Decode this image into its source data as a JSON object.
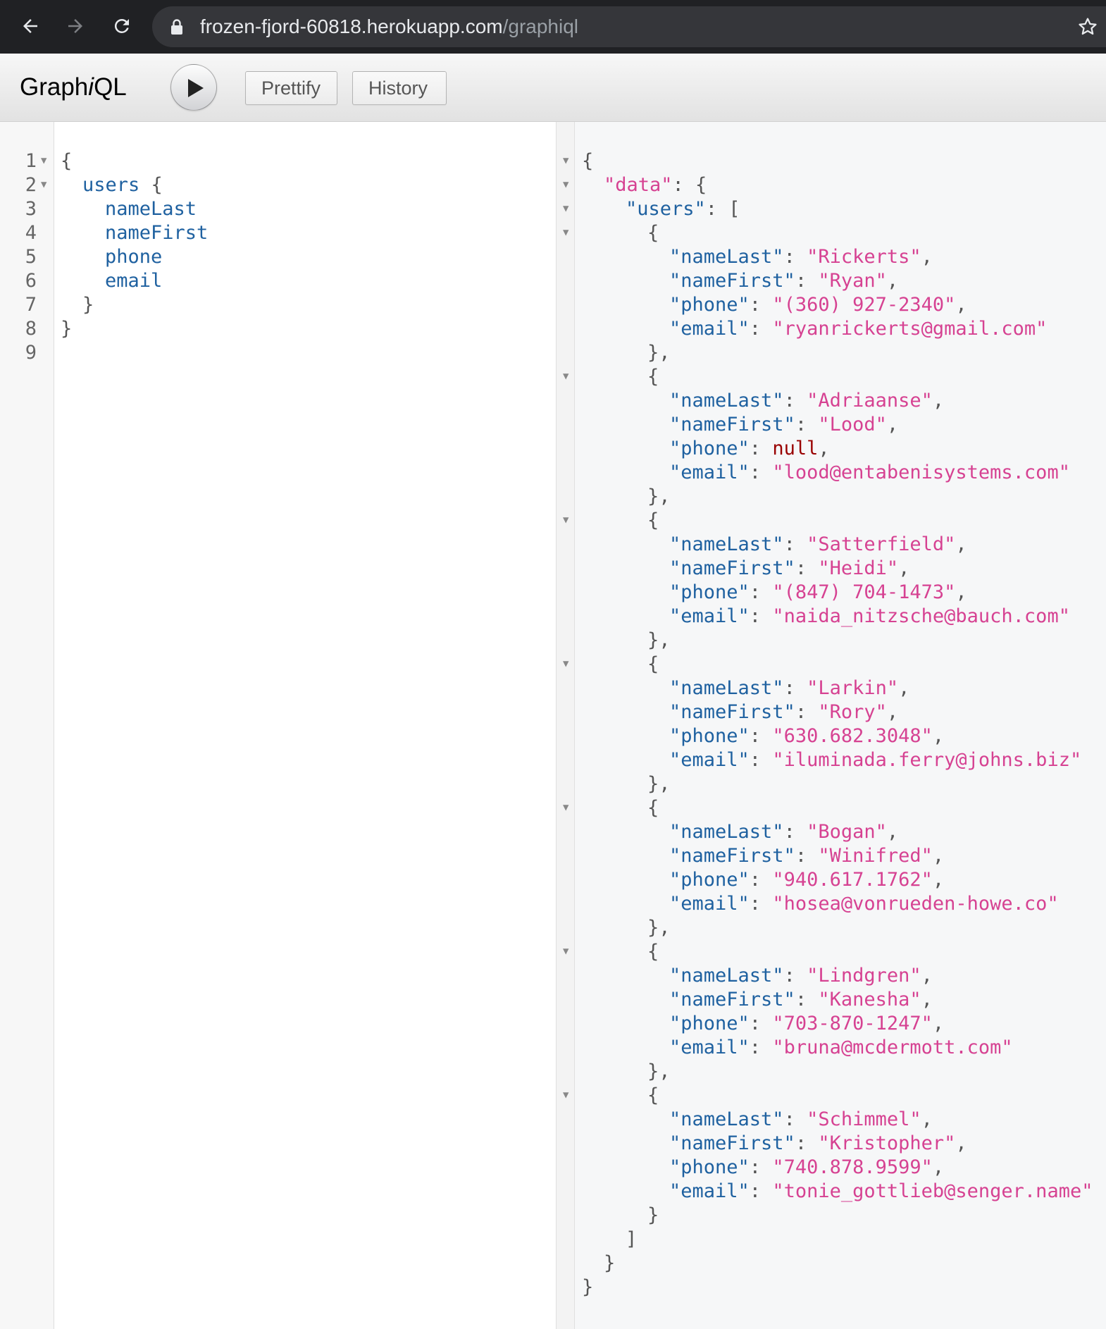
{
  "browser": {
    "url_host": "frozen-fjord-60818.herokuapp.com",
    "url_path": "/graphiql"
  },
  "toolbar": {
    "logo_prefix": "Graph",
    "logo_italic": "i",
    "logo_suffix": "QL",
    "prettify_label": "Prettify",
    "history_label": "History"
  },
  "query": {
    "line_numbers": [
      "1",
      "2",
      "3",
      "4",
      "5",
      "6",
      "7",
      "8",
      "9"
    ],
    "open_brace": "{",
    "root_field": "users",
    "root_brace": "{",
    "fields": [
      "nameLast",
      "nameFirst",
      "phone",
      "email"
    ],
    "inner_close": "}",
    "outer_close": "}"
  },
  "result": {
    "data_key": "\"data\"",
    "users_key": "\"users\"",
    "field_keys": {
      "nameLast": "\"nameLast\"",
      "nameFirst": "\"nameFirst\"",
      "phone": "\"phone\"",
      "email": "\"email\""
    },
    "users": [
      {
        "nameLast": "\"Rickerts\"",
        "nameFirst": "\"Ryan\"",
        "phone": "\"(360) 927-2340\"",
        "email": "\"ryanrickerts@gmail.com\""
      },
      {
        "nameLast": "\"Adriaanse\"",
        "nameFirst": "\"Lood\"",
        "phone": "null",
        "email": "\"lood@entabenisystems.com\""
      },
      {
        "nameLast": "\"Satterfield\"",
        "nameFirst": "\"Heidi\"",
        "phone": "\"(847) 704-1473\"",
        "email": "\"naida_nitzsche@bauch.com\""
      },
      {
        "nameLast": "\"Larkin\"",
        "nameFirst": "\"Rory\"",
        "phone": "\"630.682.3048\"",
        "email": "\"iluminada.ferry@johns.biz\""
      },
      {
        "nameLast": "\"Bogan\"",
        "nameFirst": "\"Winifred\"",
        "phone": "\"940.617.1762\"",
        "email": "\"hosea@vonrueden-howe.co\""
      },
      {
        "nameLast": "\"Lindgren\"",
        "nameFirst": "\"Kanesha\"",
        "phone": "\"703-870-1247\"",
        "email": "\"bruna@mcdermott.com\""
      },
      {
        "nameLast": "\"Schimmel\"",
        "nameFirst": "\"Kristopher\"",
        "phone": "\"740.878.9599\"",
        "email": "\"tonie_gottlieb@senger.name\""
      }
    ]
  }
}
